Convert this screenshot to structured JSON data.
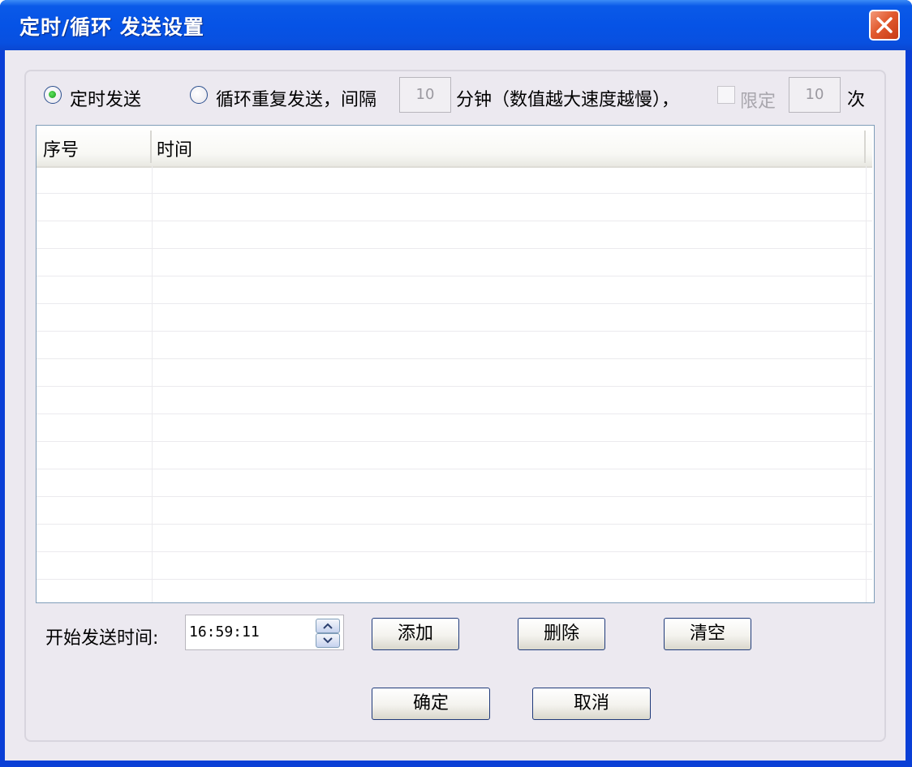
{
  "window": {
    "title": "定时/循环 发送设置"
  },
  "send_mode": {
    "timed_label": "定时发送",
    "timed_selected": true,
    "loop_label": "循环重复发送，间隔",
    "loop_selected": false,
    "interval_value": "10",
    "interval_unit": "分钟（数值越大速度越慢），",
    "limit_label": "限定",
    "limit_checked": false,
    "limit_value": "10",
    "limit_unit": "次"
  },
  "table": {
    "columns": [
      "序号",
      "时间"
    ],
    "rows": []
  },
  "start_time": {
    "label": "开始发送时间:",
    "value": "16:59:11"
  },
  "buttons": {
    "add": "添加",
    "delete": "删除",
    "clear": "清空",
    "ok": "确定",
    "cancel": "取消"
  },
  "colors": {
    "titlebar": "#0653e6",
    "client_bg": "#ece9f0",
    "close_red": "#e15a2f"
  }
}
